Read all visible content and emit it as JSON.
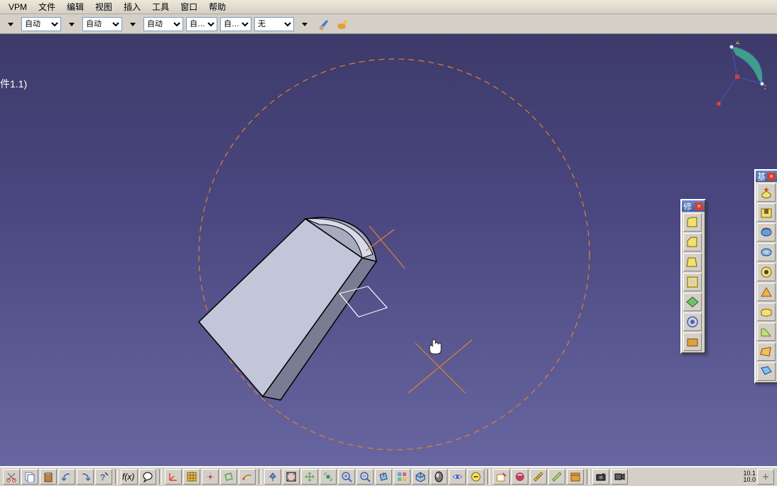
{
  "menu": {
    "items": [
      "VPM",
      "文件",
      "编辑",
      "视图",
      "插入",
      "工具",
      "窗口",
      "帮助"
    ]
  },
  "propbar": {
    "auto1": "自动",
    "auto2": "自动",
    "auto3": "自动",
    "auto4": "自…",
    "auto5": "自…",
    "none": "无"
  },
  "tree": {
    "label": "件1.1)"
  },
  "compass": {
    "z": "z",
    "x": "x"
  },
  "toolbar1": {
    "title": "修"
  },
  "toolbar2": {
    "title": "基"
  },
  "status": {
    "coords": "10.1\n10.0"
  }
}
